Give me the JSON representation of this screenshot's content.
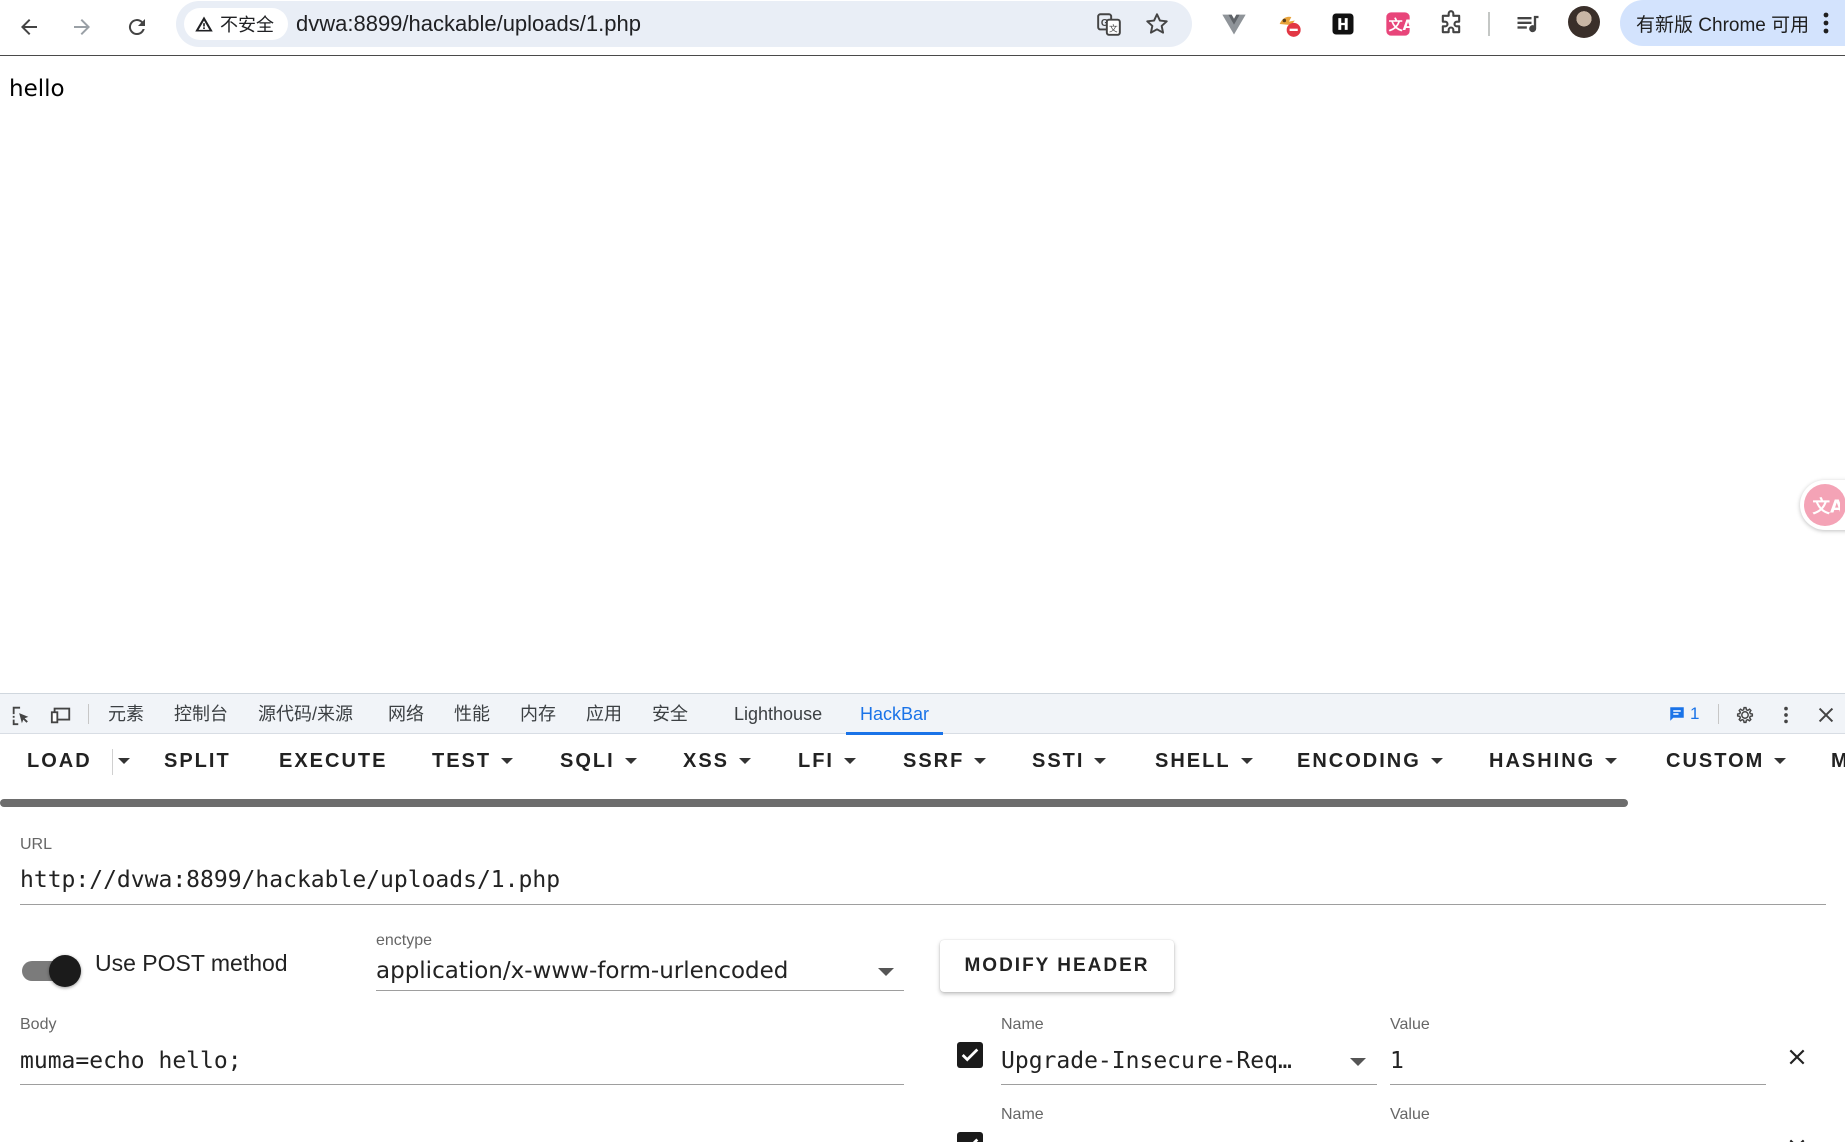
{
  "browser": {
    "security_label": "不安全",
    "address": "dvwa:8899/hackable/uploads/1.php",
    "update_label": "有新版 Chrome 可用"
  },
  "page": {
    "content_text": "hello"
  },
  "devtools": {
    "tabs": [
      "元素",
      "控制台",
      "源代码/来源",
      "网络",
      "性能",
      "内存",
      "应用",
      "安全",
      "Lighthouse",
      "HackBar"
    ],
    "active_tab": "HackBar",
    "issues_count": "1"
  },
  "hackbar": {
    "menu": {
      "load": "LOAD",
      "split": "SPLIT",
      "execute": "EXECUTE",
      "test": "TEST",
      "sqli": "SQLI",
      "xss": "XSS",
      "lfi": "LFI",
      "ssrf": "SSRF",
      "ssti": "SSTI",
      "shell": "SHELL",
      "encoding": "ENCODING",
      "hashing": "HASHING",
      "custom": "CUSTOM",
      "more": "M"
    },
    "url_label": "URL",
    "url_value": "http://dvwa:8899/hackable/uploads/1.php",
    "post_label": "Use POST method",
    "post_enabled": true,
    "enctype_label": "enctype",
    "enctype_value": "application/x-www-form-urlencoded",
    "modify_header_label": "MODIFY HEADER",
    "body_label": "Body",
    "body_value": "muma=echo hello;",
    "headers": [
      {
        "name_label": "Name",
        "name": "Upgrade-Insecure-Req…",
        "value_label": "Value",
        "value": "1",
        "checked": true
      },
      {
        "name_label": "Name",
        "name": "",
        "value_label": "Value",
        "value": "",
        "checked": true
      }
    ]
  },
  "colors": {
    "accent": "#1a73e8",
    "omnibox_bg": "#e9eef6",
    "update_pill_bg": "#d3e3fd",
    "devtools_tabbar_bg": "#f1f4f8"
  }
}
